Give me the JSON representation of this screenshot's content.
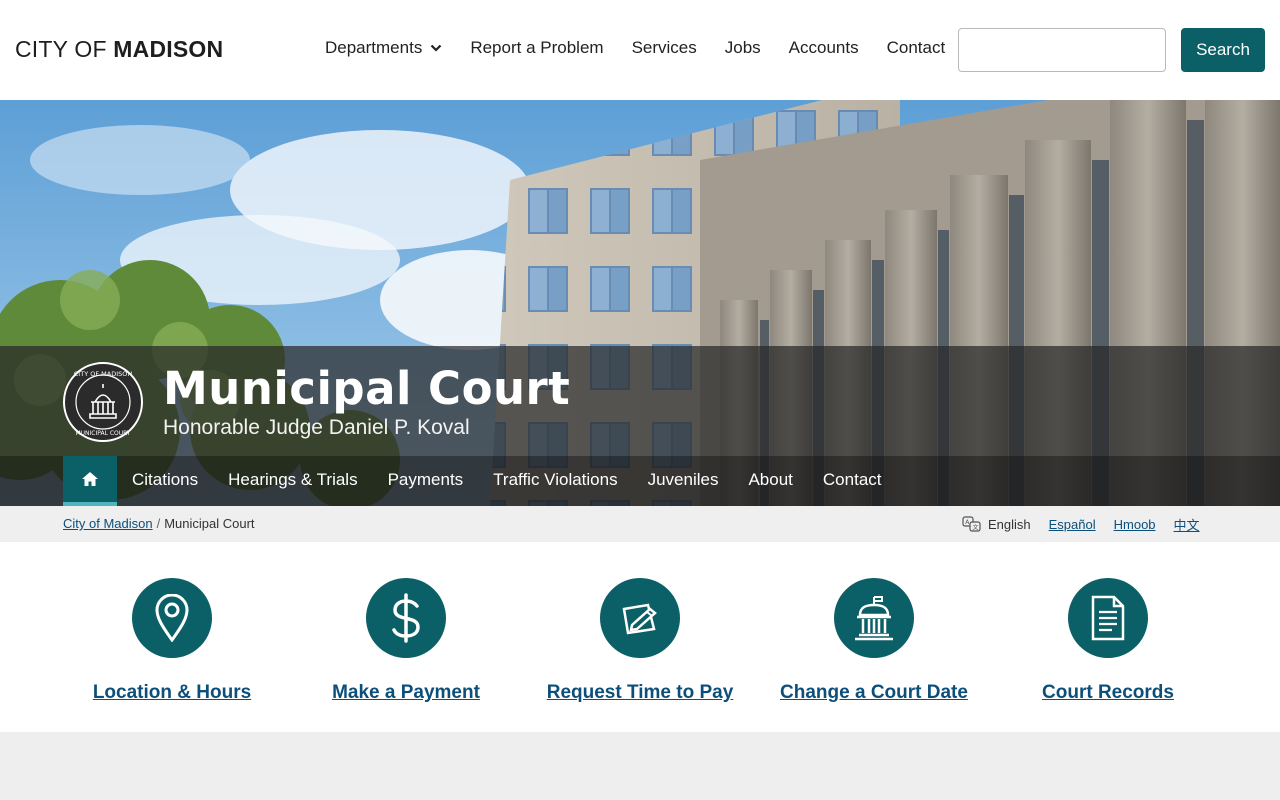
{
  "header": {
    "logo_light": "CITY OF ",
    "logo_bold": "MADISON",
    "nav": [
      {
        "label": "Departments",
        "has_dropdown": true
      },
      {
        "label": "Report a Problem"
      },
      {
        "label": "Services"
      },
      {
        "label": "Jobs"
      },
      {
        "label": "Accounts"
      },
      {
        "label": "Contact"
      }
    ],
    "search": {
      "value": "",
      "placeholder": "",
      "button_label": "Search"
    }
  },
  "hero": {
    "title": "Municipal Court",
    "subtitle": "Honorable Judge Daniel P. Koval",
    "seal_text": "CITY OF MADISON · MUNICIPAL COURT"
  },
  "subnav": {
    "home_icon": "home-icon",
    "items": [
      "Citations",
      "Hearings & Trials",
      "Payments",
      "Traffic Violations",
      "Juveniles",
      "About",
      "Contact"
    ]
  },
  "breadcrumb": {
    "home_link": "City of Madison",
    "separator": "/",
    "current": "Municipal Court"
  },
  "languages": {
    "icon": "translate-icon",
    "current": "English",
    "links": [
      "Español",
      "Hmoob",
      "中文"
    ]
  },
  "quick_links": [
    {
      "label": "Location & Hours",
      "icon": "map-pin-icon"
    },
    {
      "label": "Make a Payment",
      "icon": "dollar-icon"
    },
    {
      "label": "Request Time to Pay",
      "icon": "edit-document-icon"
    },
    {
      "label": "Change a Court Date",
      "icon": "courthouse-icon"
    },
    {
      "label": "Court Records",
      "icon": "document-icon"
    }
  ],
  "colors": {
    "accent_teal": "#0b5f66",
    "link_blue": "#0b4f7a",
    "crumb_bg": "#efefef",
    "lower_bg": "#eeeeee"
  }
}
